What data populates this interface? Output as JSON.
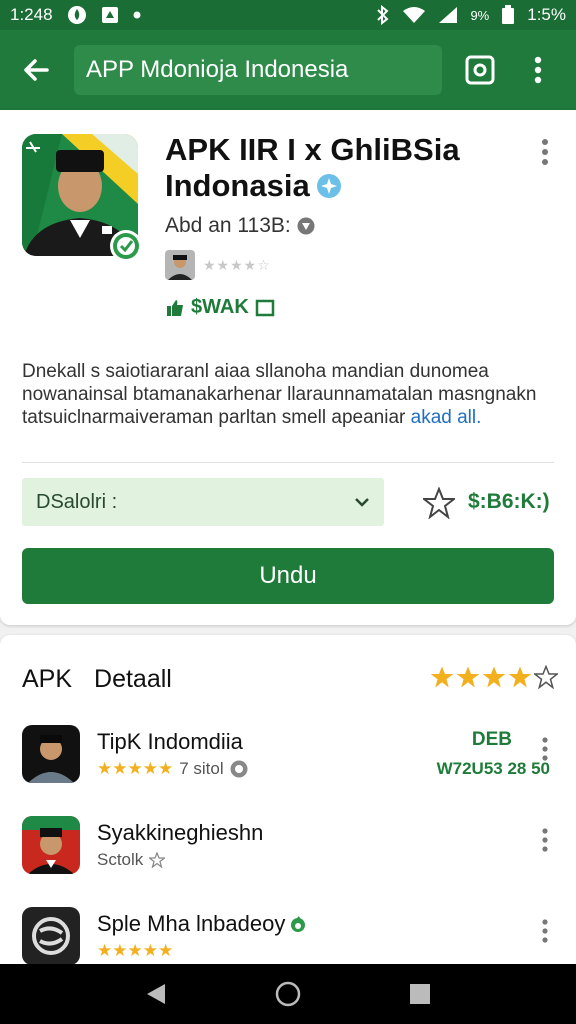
{
  "status_bar": {
    "time": "1:248",
    "battery_text": "9%",
    "battery_pct": "1:5%"
  },
  "app_bar": {
    "search_text": "APP Mdonioja Indonesia",
    "back_icon": "arrow-back-icon",
    "camera_icon": "camera-icon",
    "menu_icon": "overflow-menu-icon"
  },
  "app": {
    "title_line1": "APK IIR I x GhliBSia",
    "title_line2": "Indonasia",
    "size": "Abd an  113B:",
    "price_label": "$WAK",
    "description_text": "Dnekall s saiotiararanl aiaa sllanoha mandian dunomea nowanainsal btamanakarhenar llaraunnamatalan masngnakn tatsuiclnarmaiveraman parltan smell apeaniar",
    "read_more": "akad all.",
    "select_value": "DSalolri :",
    "price_tag": "$:B6:K:)",
    "download_label": "Undu"
  },
  "details": {
    "tab1": "APK",
    "tab2": "Detaall",
    "rating": 4,
    "items": [
      {
        "title": "TipK Indomdiia",
        "sub": "7 sitol",
        "stars": "★★★★★",
        "right_a": "DEB",
        "right_b": "W72U53 28 50"
      },
      {
        "title": "Syakkineghieshn",
        "sub": "Sctolk"
      },
      {
        "title": "Sple Mha lnbadeoy",
        "stars": "★★★★★"
      }
    ]
  },
  "colors": {
    "primary": "#1f7a3c",
    "status": "#1a6d34",
    "accent_gold": "#f2b01e"
  }
}
